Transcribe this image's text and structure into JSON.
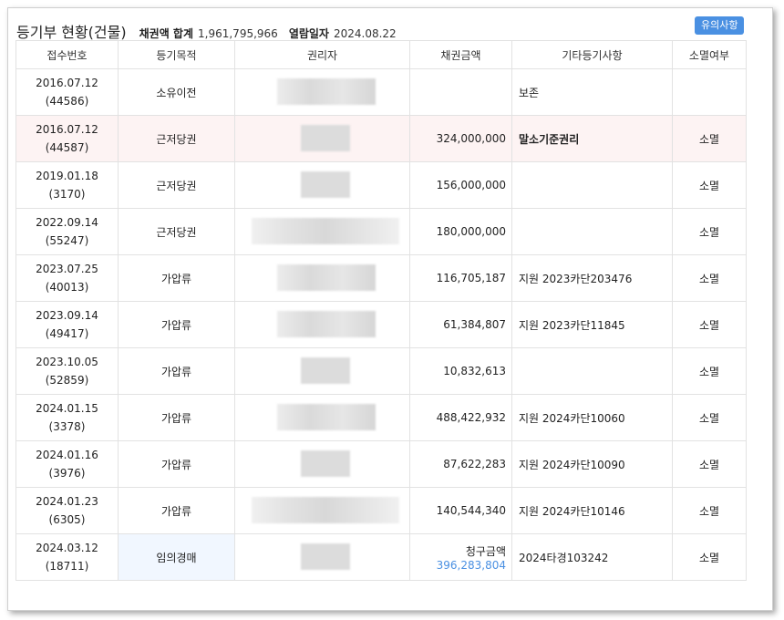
{
  "header": {
    "title": "등기부 현황(건물)",
    "claim_total_label": "채권액 합계",
    "claim_total_value": "1,961,795,966",
    "view_date_label": "열람일자",
    "view_date_value": "2024.08.22",
    "notice_button": "유의사항"
  },
  "columns": [
    "접수번호",
    "등기목적",
    "권리자",
    "채권금액",
    "기타등기사항",
    "소멸여부"
  ],
  "rows": [
    {
      "date": "2016.07.12",
      "receipt": "(44586)",
      "purpose": "소유이전",
      "amount": "",
      "etc": "보존",
      "extinct": ""
    },
    {
      "date": "2016.07.12",
      "receipt": "(44587)",
      "purpose": "근저당권",
      "amount": "324,000,000",
      "etc": "말소기준권리",
      "extinct": "소멸"
    },
    {
      "date": "2019.01.18",
      "receipt": "(3170)",
      "purpose": "근저당권",
      "amount": "156,000,000",
      "etc": "",
      "extinct": "소멸"
    },
    {
      "date": "2022.09.14",
      "receipt": "(55247)",
      "purpose": "근저당권",
      "amount": "180,000,000",
      "etc": "",
      "extinct": "소멸"
    },
    {
      "date": "2023.07.25",
      "receipt": "(40013)",
      "purpose": "가압류",
      "amount": "116,705,187",
      "etc": "지원 2023카단203476",
      "extinct": "소멸"
    },
    {
      "date": "2023.09.14",
      "receipt": "(49417)",
      "purpose": "가압류",
      "amount": "61,384,807",
      "etc": "지원 2023카단11845",
      "extinct": "소멸"
    },
    {
      "date": "2023.10.05",
      "receipt": "(52859)",
      "purpose": "가압류",
      "amount": "10,832,613",
      "etc": "",
      "extinct": "소멸"
    },
    {
      "date": "2024.01.15",
      "receipt": "(3378)",
      "purpose": "가압류",
      "amount": "488,422,932",
      "etc": "지원 2024카단10060",
      "extinct": "소멸"
    },
    {
      "date": "2024.01.16",
      "receipt": "(3976)",
      "purpose": "가압류",
      "amount": "87,622,283",
      "etc": "지원 2024카단10090",
      "extinct": "소멸"
    },
    {
      "date": "2024.01.23",
      "receipt": "(6305)",
      "purpose": "가압류",
      "amount": "140,544,340",
      "etc": "지원 2024카단10146",
      "extinct": "소멸"
    },
    {
      "date": "2024.03.12",
      "receipt": "(18711)",
      "purpose": "임의경매",
      "amount_label": "청구금액",
      "amount": "396,283,804",
      "etc": "2024타경103242",
      "extinct": "소멸"
    }
  ],
  "colors": {
    "accent": "#4a90e2",
    "highlight_row": "#fdf3f3",
    "auction_cell": "#f1f7ff"
  }
}
